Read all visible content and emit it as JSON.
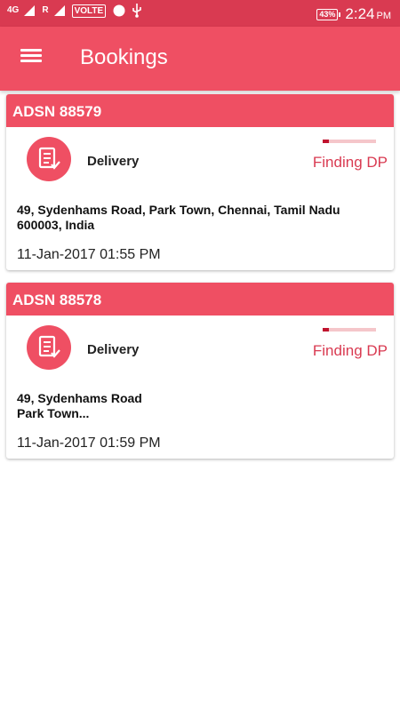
{
  "status_bar": {
    "net_4g": "4G",
    "net_r": "R",
    "volte": "VOLTE",
    "battery": "43%",
    "time": "2:24",
    "ampm": "PM"
  },
  "app_bar": {
    "title": "Bookings"
  },
  "bookings": [
    {
      "id": "ADSN 88579",
      "type": "Delivery",
      "status": "Finding DP",
      "progress": 0.12,
      "address_line1": "49, Sydenhams Road, Park Town, Chennai, Tamil Nadu",
      "address_line2": "600003, India",
      "datetime": "11-Jan-2017 01:55 PM"
    },
    {
      "id": "ADSN 88578",
      "type": "Delivery",
      "status": "Finding DP",
      "progress": 0.12,
      "address_line1": "49, Sydenhams Road",
      "address_line2": "Park Town...",
      "datetime": "11-Jan-2017 01:59 PM"
    }
  ],
  "colors": {
    "status_bar": "#d93a51",
    "primary": "#ef4f63",
    "status_text": "#d93a51",
    "progress": "#c0132e"
  }
}
